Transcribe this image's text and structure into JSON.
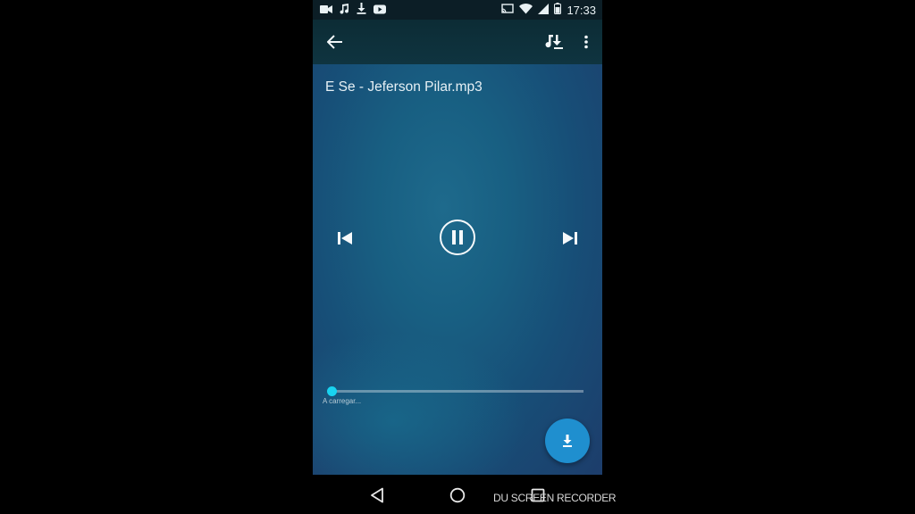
{
  "status_bar": {
    "time": "17:33",
    "left_icons": [
      "video-icon",
      "music-note-icon",
      "download-icon",
      "youtube-icon"
    ],
    "right_icons": [
      "cast-icon",
      "wifi-icon",
      "signal-icon",
      "battery-icon"
    ]
  },
  "toolbar": {
    "back_icon": "arrow-left-icon",
    "playlist_download_icon": "music-download-icon",
    "menu_icon": "more-vert-icon"
  },
  "player": {
    "track_title": "E Se - Jeferson Pilar.mp3",
    "state": "playing",
    "progress_fraction": 0.0,
    "loading_text": "A carregar..."
  },
  "nav_bar": {
    "icons": [
      "back-triangle-icon",
      "home-circle-icon",
      "recents-square-icon"
    ]
  },
  "watermark": {
    "text": "DU SCREEN RECORDER"
  },
  "colors": {
    "accent": "#19d3f0",
    "fab": "#1f8fcf",
    "toolbar": "#0f3440",
    "content_bg": "#185f82"
  }
}
